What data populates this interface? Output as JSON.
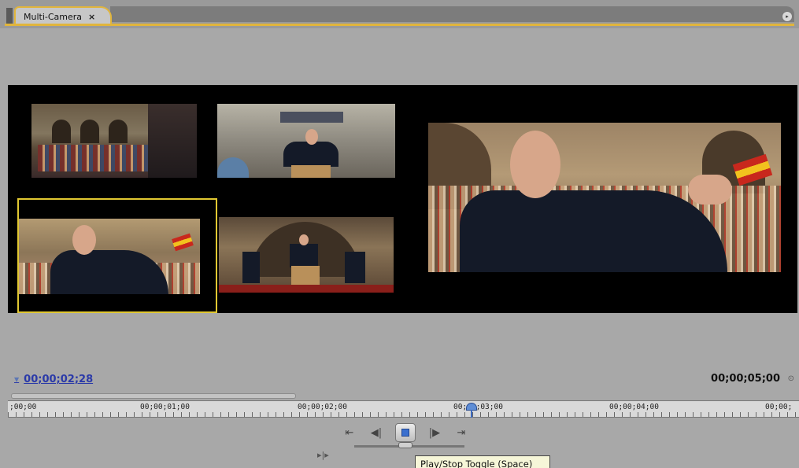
{
  "panel": {
    "tab_label": "Multi-Camera",
    "tab_close": "×",
    "menu_icon": "panel-menu-icon"
  },
  "cameras": [
    {
      "label": "camera-1"
    },
    {
      "label": "camera-2"
    },
    {
      "label": "camera-3"
    },
    {
      "label": "camera-4"
    }
  ],
  "timecode": {
    "current": "00;00;02;28",
    "duration": "00;00;05;00"
  },
  "ruler": {
    "labels": [
      ";00;00",
      "00;00;01;00",
      "00;00;02;00",
      "00;00;03;00",
      "00;00;04;00",
      "00;00;"
    ]
  },
  "transport": {
    "buttons": [
      "go-to-in-point",
      "step-back",
      "play-stop",
      "step-forward",
      "go-to-out-point"
    ]
  },
  "tooltip": {
    "text": "Play/Stop Toggle (Space)"
  },
  "colors": {
    "selection": "#e1c832",
    "timecode_link": "#2b3aa8",
    "tab_highlight": "#e1b53c"
  }
}
